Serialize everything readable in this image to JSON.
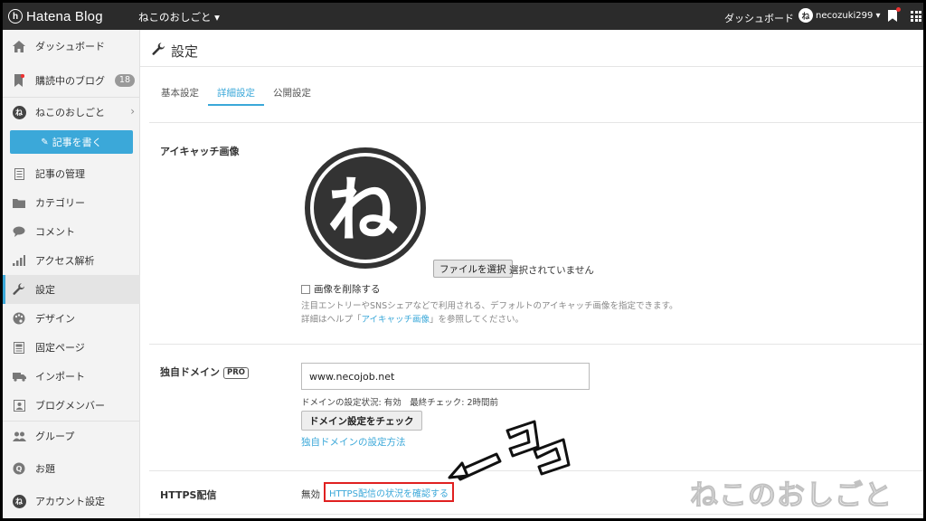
{
  "topbar": {
    "logo_mark": "h",
    "logo_text": "Hatena Blog",
    "blog_switch": "ねこのおしごと ▾",
    "dashboard": "ダッシュボード",
    "username": "necozuki299 ▾",
    "avatar_char": "ね"
  },
  "sidebar": {
    "items": [
      {
        "label": "ダッシュボード",
        "icon": "home-icon"
      },
      {
        "label": "購読中のブログ",
        "icon": "bookmark-icon",
        "badge": "18"
      },
      {
        "label": "ねこのおしごと",
        "icon": "blog-avatar"
      },
      {
        "label": "記事の管理",
        "icon": "document-icon"
      },
      {
        "label": "カテゴリー",
        "icon": "folder-icon"
      },
      {
        "label": "コメント",
        "icon": "comment-icon"
      },
      {
        "label": "アクセス解析",
        "icon": "bar-chart-icon"
      },
      {
        "label": "設定",
        "icon": "wrench-icon"
      },
      {
        "label": "デザイン",
        "icon": "palette-icon"
      },
      {
        "label": "固定ページ",
        "icon": "page-icon"
      },
      {
        "label": "インポート",
        "icon": "truck-icon"
      },
      {
        "label": "ブログメンバー",
        "icon": "members-icon"
      },
      {
        "label": "グループ",
        "icon": "group-icon"
      },
      {
        "label": "お題",
        "icon": "theme-icon"
      },
      {
        "label": "アカウント設定",
        "icon": "account-icon"
      }
    ],
    "write_button": "記事を書く"
  },
  "main": {
    "title": "設定",
    "tabs": [
      {
        "label": "基本設定"
      },
      {
        "label": "詳細設定"
      },
      {
        "label": "公開設定"
      }
    ],
    "eyecatch": {
      "label": "アイキャッチ画像",
      "image_char": "ね",
      "file_button": "ファイルを選択",
      "file_status": "選択されていません",
      "delete_label": "画像を削除する",
      "help_line1": "注目エントリーやSNSシェアなどで利用される、デフォルトのアイキャッチ画像を指定できます。",
      "help_line2_prefix": "詳細はヘルプ「",
      "help_line2_link": "アイキャッチ画像",
      "help_line2_suffix": "」を参照してください。"
    },
    "domain": {
      "label": "独自ドメイン",
      "pro": "PRO",
      "value": "www.necojob.net",
      "status": "ドメインの設定状況: 有効　最終チェック: 2時間前",
      "check_button": "ドメイン設定をチェック",
      "howto_link": "独自ドメインの設定方法"
    },
    "https": {
      "label": "HTTPS配信",
      "value": "無効",
      "status_link": "HTTPS配信の状況を確認する"
    }
  },
  "annotation": {
    "note": "ココ",
    "watermark": "ねこのおしごと"
  },
  "colors": {
    "accent": "#3ba8d9",
    "topbar": "#2b2b2b",
    "highlight_box": "#e02020"
  }
}
